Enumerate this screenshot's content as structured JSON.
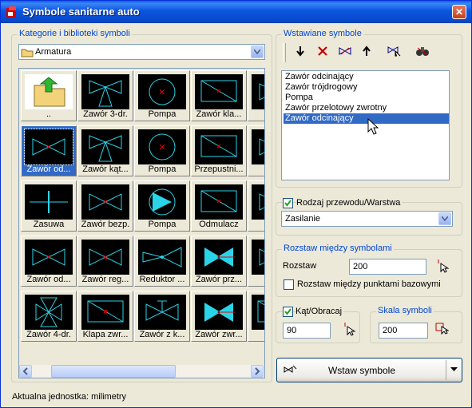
{
  "window": {
    "title": "Symbole sanitarne auto"
  },
  "left": {
    "group_title": "Kategorie i biblioteki symboli",
    "category": "Armatura",
    "tiles": [
      [
        "..",
        "Zawór 3-dr.",
        "Pompa",
        "Zawór kla...",
        "Zaw"
      ],
      [
        "Zawór od...",
        "Zawór kąt...",
        "Pompa",
        "Przepustni...",
        "Zaw"
      ],
      [
        "Zasuwa",
        "Zawór bezp.",
        "Pompa",
        "Odmulacz",
        "Zaw"
      ],
      [
        "Zawór od...",
        "Zawór reg...",
        "Reduktor ...",
        "Zawór prz...",
        "Za"
      ],
      [
        "Zawór 4-dr.",
        "Klapa zwr...",
        "Zawór z k...",
        "Zawór zwr...",
        "Od"
      ]
    ]
  },
  "right": {
    "inserted_title": "Wstawiane symbole",
    "list": [
      "Zawór odcinający",
      "Zawór trójdrogowy",
      "Pompa",
      "Zawór przelotowy zwrotny",
      "Zawór odcinający"
    ],
    "pipe_label": "Rodzaj przewodu/Warstwa",
    "pipe_value": "Zasilanie",
    "spacing_title": "Rozstaw między symbolami",
    "spacing_label": "Rozstaw",
    "spacing_value": "200",
    "spacing_base_label": "Rozstaw między punktami bazowymi",
    "angle_label": "Kąt/Obracaj",
    "angle_value": "90",
    "scale_title": "Skala symboli",
    "scale_value": "200",
    "insert_button": "Wstaw symbole"
  },
  "status": "Aktualna jednostka: milimetry"
}
